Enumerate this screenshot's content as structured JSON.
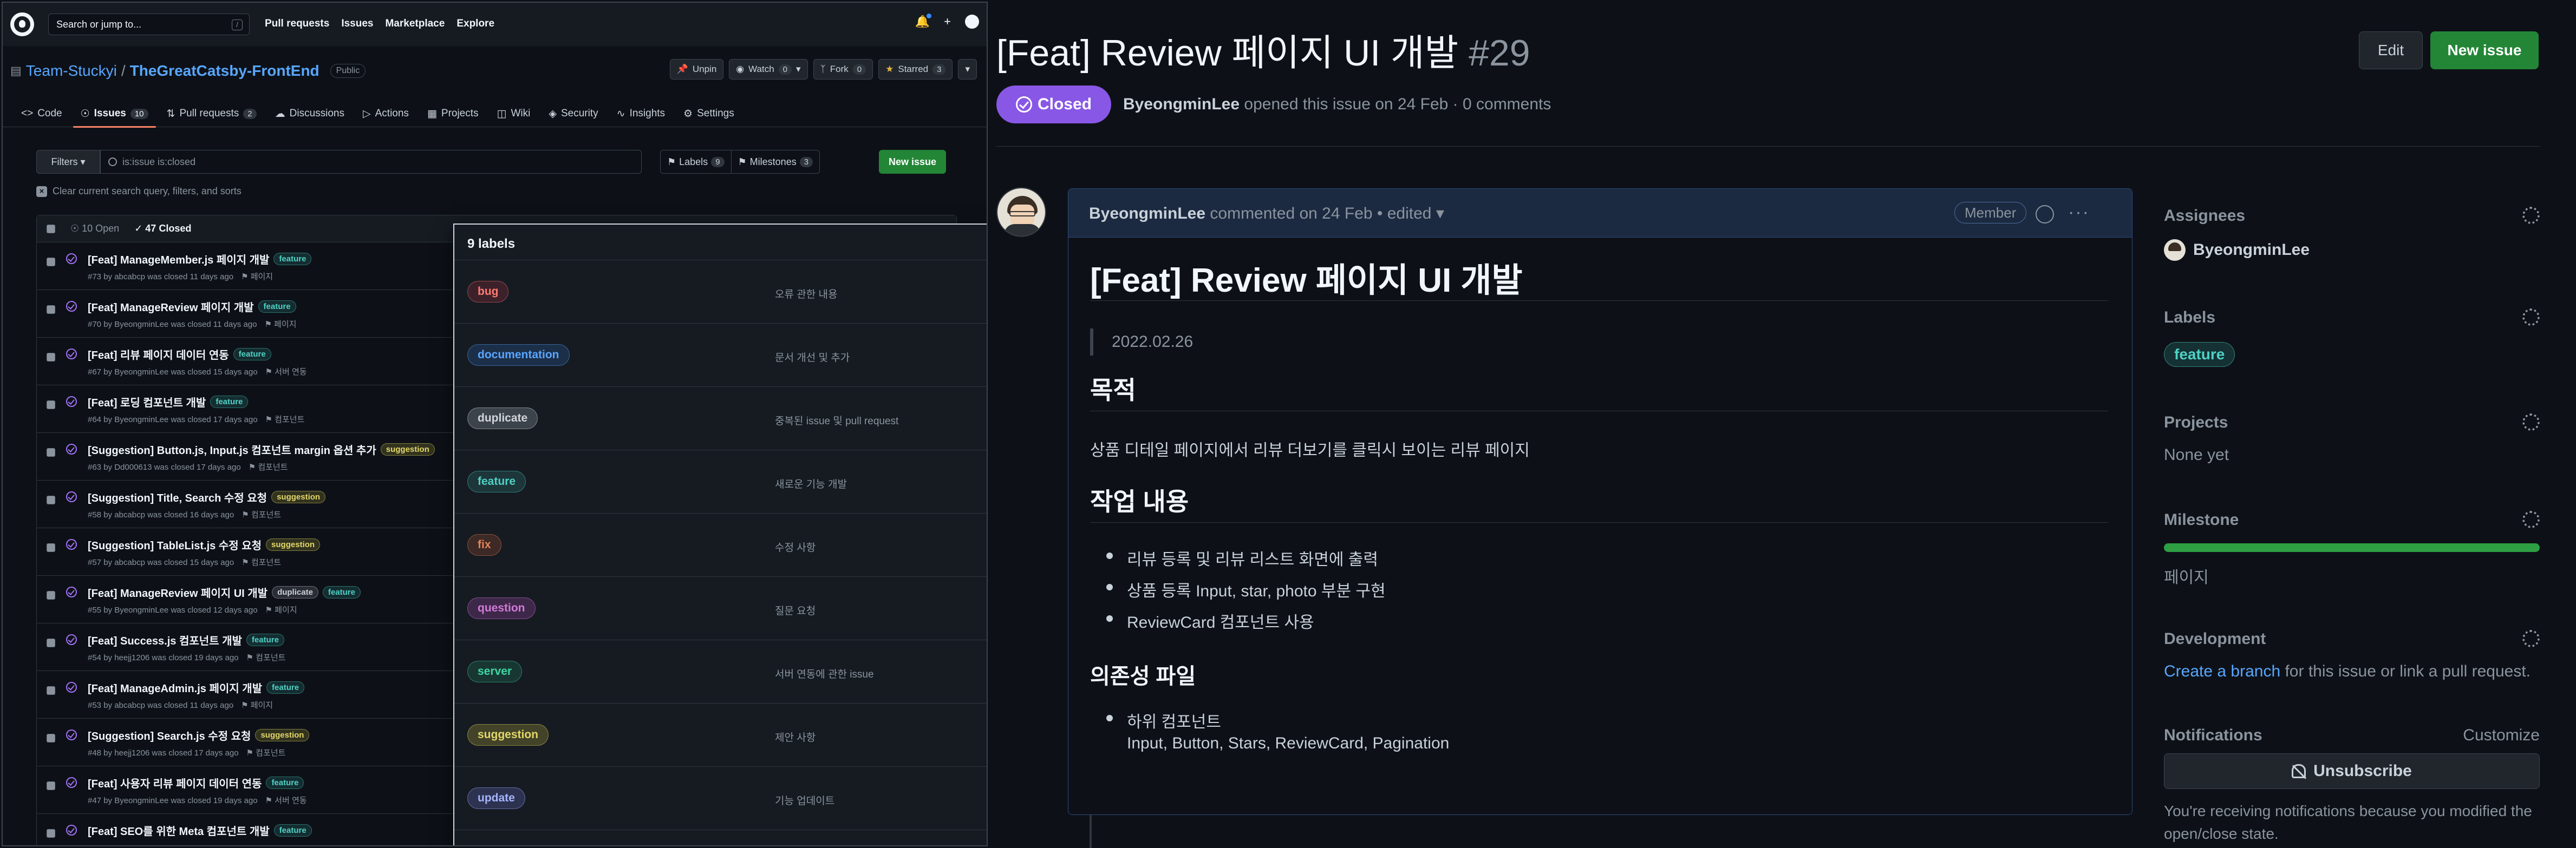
{
  "header": {
    "search_placeholder": "Search or jump to...",
    "slash_key": "/",
    "nav": [
      "Pull requests",
      "Issues",
      "Marketplace",
      "Explore"
    ],
    "plus_label": "+"
  },
  "repo": {
    "owner": "Team-Stuckyi",
    "separator": "/",
    "name": "TheGreatCatsby-FrontEnd",
    "visibility": "Public",
    "actions": {
      "unpin": "Unpin",
      "watch": "Watch",
      "watch_count": "0",
      "fork": "Fork",
      "fork_count": "0",
      "starred": "Starred",
      "star_count": "3"
    }
  },
  "tabs": [
    {
      "label": "Code",
      "count": ""
    },
    {
      "label": "Issues",
      "count": "10"
    },
    {
      "label": "Pull requests",
      "count": "2"
    },
    {
      "label": "Discussions",
      "count": ""
    },
    {
      "label": "Actions",
      "count": ""
    },
    {
      "label": "Projects",
      "count": ""
    },
    {
      "label": "Wiki",
      "count": ""
    },
    {
      "label": "Security",
      "count": ""
    },
    {
      "label": "Insights",
      "count": ""
    },
    {
      "label": "Settings",
      "count": ""
    }
  ],
  "filters": {
    "button": "Filters",
    "query": "is:issue is:closed",
    "labels": "Labels",
    "labels_count": "9",
    "milestones": "Milestones",
    "milestones_count": "3",
    "new_issue": "New issue",
    "clear": "Clear current search query, filters, and sorts"
  },
  "issues_list": {
    "open": "10 Open",
    "closed": "47 Closed",
    "items": [
      {
        "title": "[Feat] ManageMember.js 페이지 개발",
        "labels": [
          "feature"
        ],
        "meta": "#73 by abcabcp was closed 11 days ago",
        "milestone": "페이지"
      },
      {
        "title": "[Feat] ManageReview 페이지 개발",
        "labels": [
          "feature"
        ],
        "meta": "#70 by ByeongminLee was closed 11 days ago",
        "milestone": "페이지"
      },
      {
        "title": "[Feat] 리뷰 페이지 데이터 연동",
        "labels": [
          "feature"
        ],
        "meta": "#67 by ByeongminLee was closed 15 days ago",
        "milestone": "서버 연동"
      },
      {
        "title": "[Feat] 로딩 컴포넌트 개발",
        "labels": [
          "feature"
        ],
        "meta": "#64 by ByeongminLee was closed 17 days ago",
        "milestone": "컴포넌트"
      },
      {
        "title": "[Suggestion] Button.js, Input.js 컴포넌트 margin 옵션 추가",
        "labels": [
          "suggestion"
        ],
        "meta": "#63 by Dd000613 was closed 17 days ago",
        "milestone": "컴포넌트"
      },
      {
        "title": "[Suggestion] Title, Search 수정 요청",
        "labels": [
          "suggestion"
        ],
        "meta": "#58 by abcabcp was closed 16 days ago",
        "milestone": "컴포넌트"
      },
      {
        "title": "[Suggestion] TableList.js 수정 요청",
        "labels": [
          "suggestion"
        ],
        "meta": "#57 by abcabcp was closed 15 days ago",
        "milestone": "컴포넌트"
      },
      {
        "title": "[Feat] ManageReview 페이지 UI 개발",
        "labels": [
          "duplicate",
          "feature"
        ],
        "meta": "#55 by ByeongminLee was closed 12 days ago",
        "milestone": "페이지"
      },
      {
        "title": "[Feat] Success.js 컴포넌트 개발",
        "labels": [
          "feature"
        ],
        "meta": "#54 by heejj1206 was closed 19 days ago",
        "milestone": "컴포넌트"
      },
      {
        "title": "[Feat] ManageAdmin.js 페이지 개발",
        "labels": [
          "feature"
        ],
        "meta": "#53 by abcabcp was closed 11 days ago",
        "milestone": "페이지"
      },
      {
        "title": "[Suggestion] Search.js 수정 요청",
        "labels": [
          "suggestion"
        ],
        "meta": "#48 by heejj1206 was closed 17 days ago",
        "milestone": "컴포넌트"
      },
      {
        "title": "[Feat] 사용자 리뷰 페이지 데이터 연동",
        "labels": [
          "feature"
        ],
        "meta": "#47 by ByeongminLee was closed 19 days ago",
        "milestone": "서버 연동"
      },
      {
        "title": "[Feat] SEO를 위한 Meta 컴포넌트 개발",
        "labels": [
          "feature"
        ],
        "meta": "",
        "milestone": ""
      }
    ]
  },
  "labels_popup": {
    "title": "9 labels",
    "items": [
      {
        "name": "bug",
        "desc": "오류 관한 내용"
      },
      {
        "name": "documentation",
        "desc": "문서 개선 및 추가"
      },
      {
        "name": "duplicate",
        "desc": "중복된 issue 및 pull request"
      },
      {
        "name": "feature",
        "desc": "새로운 기능 개발"
      },
      {
        "name": "fix",
        "desc": "수정 사항"
      },
      {
        "name": "question",
        "desc": "질문 요청"
      },
      {
        "name": "server",
        "desc": "서버 연동에 관한 issue"
      },
      {
        "name": "suggestion",
        "desc": "제안 사항"
      },
      {
        "name": "update",
        "desc": "기능 업데이트"
      }
    ]
  },
  "issue": {
    "title": "[Feat] Review 페이지 UI 개발",
    "number": "#29",
    "edit": "Edit",
    "new_issue": "New issue",
    "state": "Closed",
    "author": "ByeongminLee",
    "opened_text": "opened this issue on 24 Feb · 0 comments"
  },
  "comment": {
    "author": "ByeongminLee",
    "meta": "commented on 24 Feb • edited",
    "role": "Member",
    "h1": "[Feat] Review 페이지 UI 개발",
    "date": "2022.02.26",
    "purpose_h": "목적",
    "purpose_p": "상품 디테일 페이지에서 리뷰 더보기를 클릭시 보이는 리뷰 페이지",
    "work_h": "작업 내용",
    "work_items": [
      "리뷰 등록 및 리뷰 리스트 화면에 출력",
      "상품 등록 Input, star, photo 부분 구현",
      "ReviewCard 컴포넌트 사용"
    ],
    "deps_h": "의존성 파일",
    "deps_item": "하위 컴포넌트",
    "deps_sub": "Input, Button, Stars, ReviewCard, Pagination"
  },
  "sidebar": {
    "assignees_h": "Assignees",
    "assignee": "ByeongminLee",
    "labels_h": "Labels",
    "label": "feature",
    "projects_h": "Projects",
    "projects_val": "None yet",
    "milestone_h": "Milestone",
    "milestone_progress": 1.0,
    "milestone_val": "페이지",
    "development_h": "Development",
    "dev_link": "Create a branch",
    "dev_rest": " for this issue or link a pull request.",
    "notifications_h": "Notifications",
    "customize": "Customize",
    "unsubscribe": "Unsubscribe",
    "notif_text": "You're receiving notifications because you modified the open/close state."
  },
  "colors": {
    "accent_green": "#238636",
    "closed_purple": "#8957e5",
    "link_blue": "#58a6ff"
  }
}
